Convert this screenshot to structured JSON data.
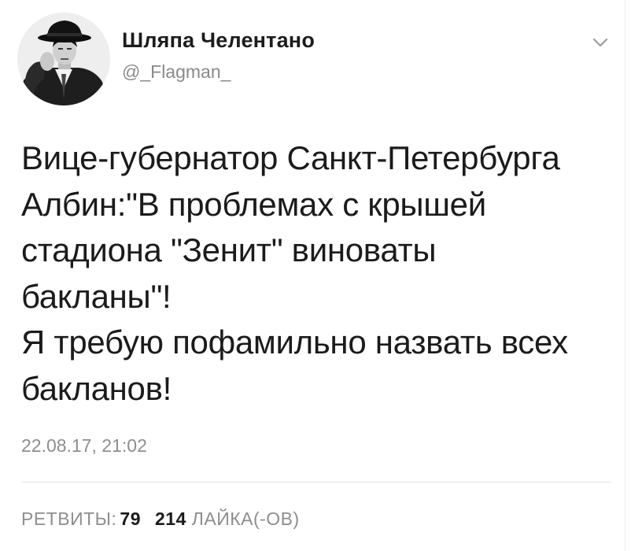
{
  "user": {
    "display_name": "Шляпа Челентано",
    "handle": "@_Flagman_",
    "avatar_icon": "user-avatar-photo"
  },
  "menu": {
    "icon": "chevron-down-icon"
  },
  "tweet": {
    "lines": [
      "Вице-губернатор Санкт-Петербурга",
      "Албин:\"В проблемах с крышей",
      "стадиона \"Зенит\" виноваты",
      "бакланы\"!",
      "Я требую пофамильно назвать всех",
      "бакланов!"
    ],
    "timestamp": "22.08.17, 21:02"
  },
  "stats": {
    "retweets_label": "РЕТВИТЫ:",
    "retweets_count": "79",
    "likes_count": "214",
    "likes_label": "ЛАЙКА(-ОВ)"
  },
  "colors": {
    "text": "#1b1b1b",
    "muted": "#8e8e8e",
    "divider": "#e3e3e3"
  }
}
